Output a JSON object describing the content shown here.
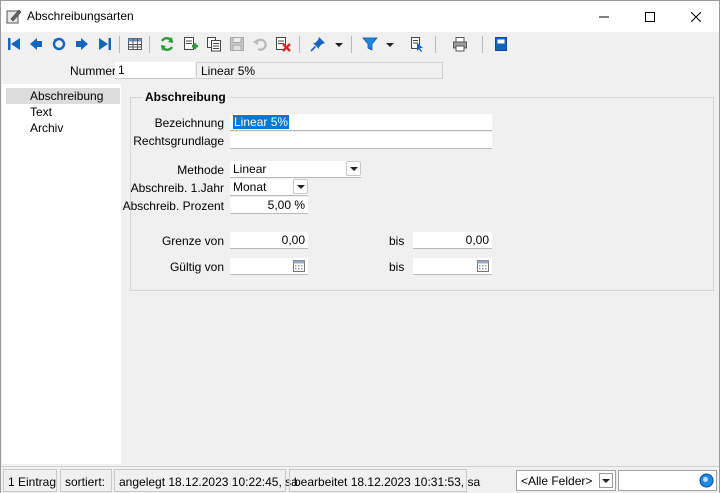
{
  "window": {
    "title": "Abschreibungsarten",
    "minimize_icon": "minimize-icon",
    "maximize_icon": "maximize-icon",
    "close_icon": "close-icon"
  },
  "toolbar": {
    "icons": [
      "first-record-icon",
      "previous-record-icon",
      "undo-navigation-icon",
      "next-record-icon",
      "last-record-icon",
      "table-view-icon",
      "refresh-icon",
      "new-record-icon",
      "copy-record-icon",
      "save-icon",
      "undo-icon",
      "delete-icon",
      "pin-icon",
      "filter-icon",
      "assign-icon",
      "print-icon",
      "book-icon"
    ]
  },
  "header": {
    "nummer_label": "Nummer",
    "nummer_value": "1",
    "nummer_description": "Linear 5%"
  },
  "nav": {
    "items": [
      {
        "label": "Abschreibung",
        "selected": true
      },
      {
        "label": "Text",
        "selected": false
      },
      {
        "label": "Archiv",
        "selected": false
      }
    ]
  },
  "form": {
    "group_title": "Abschreibung",
    "bezeichnung_label": "Bezeichnung",
    "bezeichnung_value": "Linear 5%",
    "rechtsgrundlage_label": "Rechtsgrundlage",
    "rechtsgrundlage_value": "",
    "methode_label": "Methode",
    "methode_value": "Linear",
    "abschreib_jahr_label": "Abschreib. 1.Jahr",
    "abschreib_jahr_value": "Monat",
    "abschreib_prozent_label": "Abschreib. Prozent",
    "abschreib_prozent_value": "5,00 %",
    "grenze_von_label": "Grenze von",
    "grenze_von_value": "0,00",
    "grenze_bis_label": "bis",
    "grenze_bis_value": "0,00",
    "gueltig_von_label": "Gültig von",
    "gueltig_von_value": "",
    "gueltig_bis_label": "bis",
    "gueltig_bis_value": ""
  },
  "status": {
    "count": "1 Eintrag",
    "sorted": "sortiert:",
    "created": "angelegt 18.12.2023 10:22:45, sa",
    "edited": "bearbeitet 18.12.2023 10:31:53, sa",
    "field_filter": "<Alle Felder>",
    "search_value": ""
  },
  "colors": {
    "accent": "#0078d7",
    "nav_arrow": "#1565c0",
    "refresh_green": "#2e9b3a",
    "delete_red": "#d62828"
  }
}
